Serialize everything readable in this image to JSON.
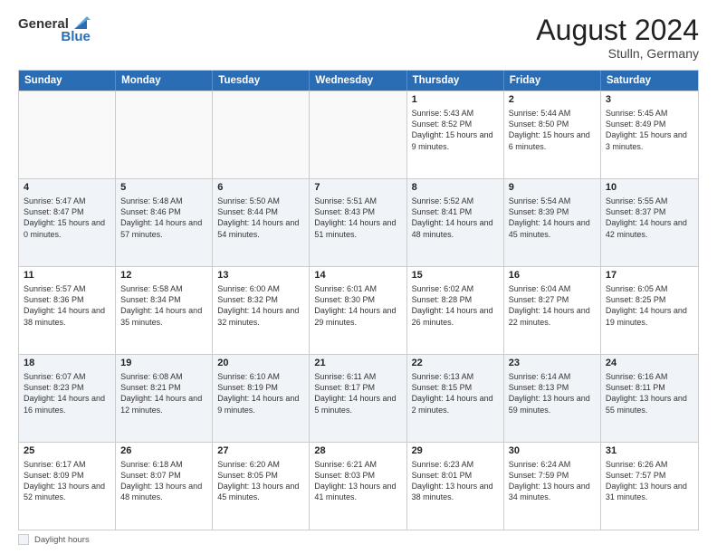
{
  "logo": {
    "general": "General",
    "blue": "Blue"
  },
  "title": {
    "month_year": "August 2024",
    "location": "Stulln, Germany"
  },
  "calendar": {
    "headers": [
      "Sunday",
      "Monday",
      "Tuesday",
      "Wednesday",
      "Thursday",
      "Friday",
      "Saturday"
    ],
    "rows": [
      [
        {
          "day": "",
          "info": "",
          "empty": true
        },
        {
          "day": "",
          "info": "",
          "empty": true
        },
        {
          "day": "",
          "info": "",
          "empty": true
        },
        {
          "day": "",
          "info": "",
          "empty": true
        },
        {
          "day": "1",
          "info": "Sunrise: 5:43 AM\nSunset: 8:52 PM\nDaylight: 15 hours and 9 minutes.",
          "empty": false
        },
        {
          "day": "2",
          "info": "Sunrise: 5:44 AM\nSunset: 8:50 PM\nDaylight: 15 hours and 6 minutes.",
          "empty": false
        },
        {
          "day": "3",
          "info": "Sunrise: 5:45 AM\nSunset: 8:49 PM\nDaylight: 15 hours and 3 minutes.",
          "empty": false
        }
      ],
      [
        {
          "day": "4",
          "info": "Sunrise: 5:47 AM\nSunset: 8:47 PM\nDaylight: 15 hours and 0 minutes.",
          "empty": false
        },
        {
          "day": "5",
          "info": "Sunrise: 5:48 AM\nSunset: 8:46 PM\nDaylight: 14 hours and 57 minutes.",
          "empty": false
        },
        {
          "day": "6",
          "info": "Sunrise: 5:50 AM\nSunset: 8:44 PM\nDaylight: 14 hours and 54 minutes.",
          "empty": false
        },
        {
          "day": "7",
          "info": "Sunrise: 5:51 AM\nSunset: 8:43 PM\nDaylight: 14 hours and 51 minutes.",
          "empty": false
        },
        {
          "day": "8",
          "info": "Sunrise: 5:52 AM\nSunset: 8:41 PM\nDaylight: 14 hours and 48 minutes.",
          "empty": false
        },
        {
          "day": "9",
          "info": "Sunrise: 5:54 AM\nSunset: 8:39 PM\nDaylight: 14 hours and 45 minutes.",
          "empty": false
        },
        {
          "day": "10",
          "info": "Sunrise: 5:55 AM\nSunset: 8:37 PM\nDaylight: 14 hours and 42 minutes.",
          "empty": false
        }
      ],
      [
        {
          "day": "11",
          "info": "Sunrise: 5:57 AM\nSunset: 8:36 PM\nDaylight: 14 hours and 38 minutes.",
          "empty": false
        },
        {
          "day": "12",
          "info": "Sunrise: 5:58 AM\nSunset: 8:34 PM\nDaylight: 14 hours and 35 minutes.",
          "empty": false
        },
        {
          "day": "13",
          "info": "Sunrise: 6:00 AM\nSunset: 8:32 PM\nDaylight: 14 hours and 32 minutes.",
          "empty": false
        },
        {
          "day": "14",
          "info": "Sunrise: 6:01 AM\nSunset: 8:30 PM\nDaylight: 14 hours and 29 minutes.",
          "empty": false
        },
        {
          "day": "15",
          "info": "Sunrise: 6:02 AM\nSunset: 8:28 PM\nDaylight: 14 hours and 26 minutes.",
          "empty": false
        },
        {
          "day": "16",
          "info": "Sunrise: 6:04 AM\nSunset: 8:27 PM\nDaylight: 14 hours and 22 minutes.",
          "empty": false
        },
        {
          "day": "17",
          "info": "Sunrise: 6:05 AM\nSunset: 8:25 PM\nDaylight: 14 hours and 19 minutes.",
          "empty": false
        }
      ],
      [
        {
          "day": "18",
          "info": "Sunrise: 6:07 AM\nSunset: 8:23 PM\nDaylight: 14 hours and 16 minutes.",
          "empty": false
        },
        {
          "day": "19",
          "info": "Sunrise: 6:08 AM\nSunset: 8:21 PM\nDaylight: 14 hours and 12 minutes.",
          "empty": false
        },
        {
          "day": "20",
          "info": "Sunrise: 6:10 AM\nSunset: 8:19 PM\nDaylight: 14 hours and 9 minutes.",
          "empty": false
        },
        {
          "day": "21",
          "info": "Sunrise: 6:11 AM\nSunset: 8:17 PM\nDaylight: 14 hours and 5 minutes.",
          "empty": false
        },
        {
          "day": "22",
          "info": "Sunrise: 6:13 AM\nSunset: 8:15 PM\nDaylight: 14 hours and 2 minutes.",
          "empty": false
        },
        {
          "day": "23",
          "info": "Sunrise: 6:14 AM\nSunset: 8:13 PM\nDaylight: 13 hours and 59 minutes.",
          "empty": false
        },
        {
          "day": "24",
          "info": "Sunrise: 6:16 AM\nSunset: 8:11 PM\nDaylight: 13 hours and 55 minutes.",
          "empty": false
        }
      ],
      [
        {
          "day": "25",
          "info": "Sunrise: 6:17 AM\nSunset: 8:09 PM\nDaylight: 13 hours and 52 minutes.",
          "empty": false
        },
        {
          "day": "26",
          "info": "Sunrise: 6:18 AM\nSunset: 8:07 PM\nDaylight: 13 hours and 48 minutes.",
          "empty": false
        },
        {
          "day": "27",
          "info": "Sunrise: 6:20 AM\nSunset: 8:05 PM\nDaylight: 13 hours and 45 minutes.",
          "empty": false
        },
        {
          "day": "28",
          "info": "Sunrise: 6:21 AM\nSunset: 8:03 PM\nDaylight: 13 hours and 41 minutes.",
          "empty": false
        },
        {
          "day": "29",
          "info": "Sunrise: 6:23 AM\nSunset: 8:01 PM\nDaylight: 13 hours and 38 minutes.",
          "empty": false
        },
        {
          "day": "30",
          "info": "Sunrise: 6:24 AM\nSunset: 7:59 PM\nDaylight: 13 hours and 34 minutes.",
          "empty": false
        },
        {
          "day": "31",
          "info": "Sunrise: 6:26 AM\nSunset: 7:57 PM\nDaylight: 13 hours and 31 minutes.",
          "empty": false
        }
      ]
    ]
  },
  "footer": {
    "label": "Daylight hours"
  }
}
